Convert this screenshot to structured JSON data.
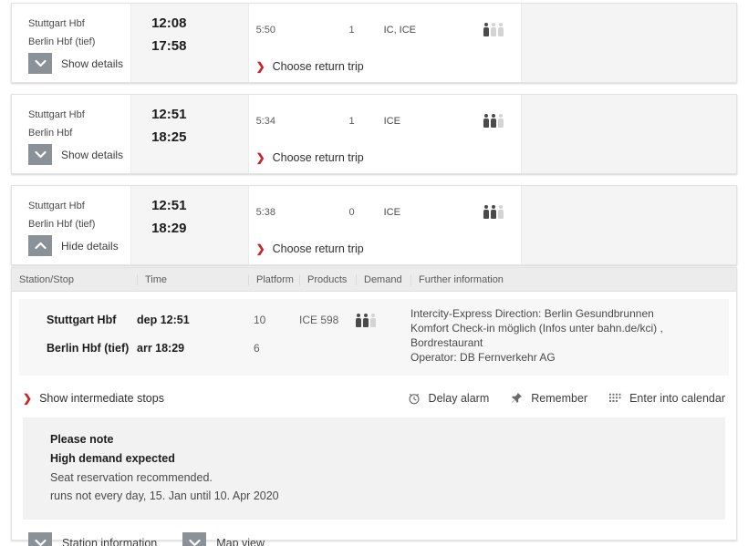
{
  "connections": [
    {
      "origin": "Stuttgart Hbf",
      "destination": "Berlin Hbf (tief)",
      "dep_time": "12:08",
      "arr_time": "17:58",
      "duration": "5:50",
      "changes": "1",
      "products": "IC, ICE",
      "demand_icon": "demand-level-icon",
      "demand_level": 1,
      "toggle_label": "Show details",
      "toggle_icon": "chevron-down-icon",
      "return_label": "Choose return trip",
      "return_icon": "arrow-right-icon"
    },
    {
      "origin": "Stuttgart Hbf",
      "destination": "Berlin Hbf",
      "dep_time": "12:51",
      "arr_time": "18:25",
      "duration": "5:34",
      "changes": "1",
      "products": "ICE",
      "demand_icon": "demand-level-icon",
      "demand_level": 2,
      "toggle_label": "Show details",
      "toggle_icon": "chevron-down-icon",
      "return_label": "Choose return trip",
      "return_icon": "arrow-right-icon"
    },
    {
      "origin": "Stuttgart Hbf",
      "destination": "Berlin Hbf (tief)",
      "dep_time": "12:51",
      "arr_time": "18:29",
      "duration": "5:38",
      "changes": "0",
      "products": "ICE",
      "demand_icon": "demand-level-icon",
      "demand_level": 2,
      "toggle_label": "Hide details",
      "toggle_icon": "chevron-up-icon",
      "return_label": "Choose return trip",
      "return_icon": "arrow-right-icon"
    }
  ],
  "details": {
    "columns": {
      "station": "Station/Stop",
      "time": "Time",
      "platform": "Platform",
      "products": "Products",
      "demand": "Demand",
      "further": "Further information"
    },
    "departure": {
      "station": "Stuttgart Hbf",
      "time": "dep 12:51",
      "platform": "10",
      "product": "ICE 598",
      "demand_icon": "demand-level-icon",
      "demand_level": 2
    },
    "arrival": {
      "station": "Berlin Hbf (tief)",
      "time": "arr 18:29",
      "platform": "6",
      "product": "",
      "demand_icon": ""
    },
    "further_information": [
      "Intercity-Express Direction: Berlin Gesundbrunnen",
      "Komfort Check-in möglich (Infos unter bahn.de/kci) ,",
      "Bordrestaurant",
      "Operator: DB Fernverkehr AG"
    ],
    "actions": {
      "intermediate_stops": {
        "label": "Show intermediate stops",
        "icon": "arrow-right-icon"
      },
      "delay_alarm": {
        "label": "Delay alarm",
        "icon": "alarm-clock-icon"
      },
      "remember": {
        "label": "Remember",
        "icon": "pushpin-icon"
      },
      "calendar": {
        "label": "Enter into calendar",
        "icon": "calendar-icon"
      }
    },
    "note": {
      "title": "Please note",
      "subtitle": "High demand expected",
      "lines": [
        "Seat reservation recommended.",
        "runs not every day, 15. Jan until 10. Apr 2020"
      ]
    },
    "footer": {
      "station_information": {
        "label": "Station information",
        "icon": "chevron-down-icon"
      },
      "map_view": {
        "label": "Map view",
        "icon": "chevron-down-icon"
      }
    }
  },
  "colors": {
    "accent_red": "#c9242c",
    "chevron_button": "#8a9199",
    "panel_bg": "#f4f4f4",
    "header_bg": "#ececec"
  }
}
